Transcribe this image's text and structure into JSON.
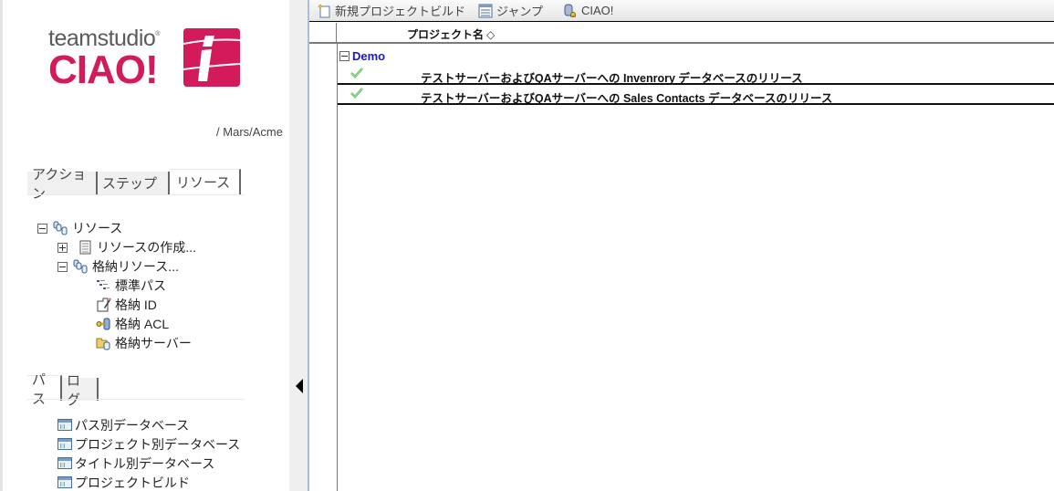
{
  "branding": {
    "product_small": "teamstudio",
    "registered_mark": "®",
    "product_large": "CIAO!",
    "brand_color": "#d31a5b"
  },
  "user_path": "/ Mars/Acme",
  "sidebar": {
    "tabs_primary": [
      {
        "label": "アクション",
        "active": false
      },
      {
        "label": "ステップ",
        "active": false
      },
      {
        "label": "リソース",
        "active": true
      }
    ],
    "tree": {
      "root": {
        "label": "リソース",
        "icon": "database-group-icon",
        "expanded": true
      },
      "children": [
        {
          "label": "リソースの作成...",
          "icon": "form-document-icon",
          "expanded": false
        },
        {
          "label": "格納リソース...",
          "icon": "database-group-icon",
          "expanded": true,
          "children": [
            {
              "label": "標準パス",
              "icon": "hierarchy-icon"
            },
            {
              "label": "格納 ID",
              "icon": "edit-document-icon"
            },
            {
              "label": "格納 ACL",
              "icon": "key-database-icon"
            },
            {
              "label": "格納サーバー",
              "icon": "folder-database-icon"
            }
          ]
        }
      ]
    },
    "tabs_secondary": [
      {
        "label": "パス",
        "active": true
      },
      {
        "label": "ログ",
        "active": false
      }
    ],
    "views": [
      {
        "label": "パス別データベース",
        "icon": "view-icon"
      },
      {
        "label": "プロジェクト別データベース",
        "icon": "view-icon"
      },
      {
        "label": "タイトル別データベース",
        "icon": "view-icon"
      },
      {
        "label": "プロジェクトビルド",
        "icon": "view-icon"
      }
    ]
  },
  "toolbar": {
    "buttons": [
      {
        "label": "新規プロジェクトビルド",
        "icon": "new-document-icon"
      },
      {
        "label": "ジャンプ",
        "icon": "list-icon"
      },
      {
        "label": "CIAO!",
        "icon": "database-key-icon"
      }
    ]
  },
  "grid": {
    "column_title": "プロジェクト名",
    "sort_indicator": "◇",
    "category": {
      "label": "Demo",
      "expanded": true
    },
    "rows": [
      {
        "status": "check",
        "title": "テストサーバーおよびQAサーバーへの Invenrory データベースのリリース"
      },
      {
        "status": "check",
        "title": "テストサーバーおよびQAサーバーへの Sales Contacts データベースのリリース"
      }
    ]
  }
}
